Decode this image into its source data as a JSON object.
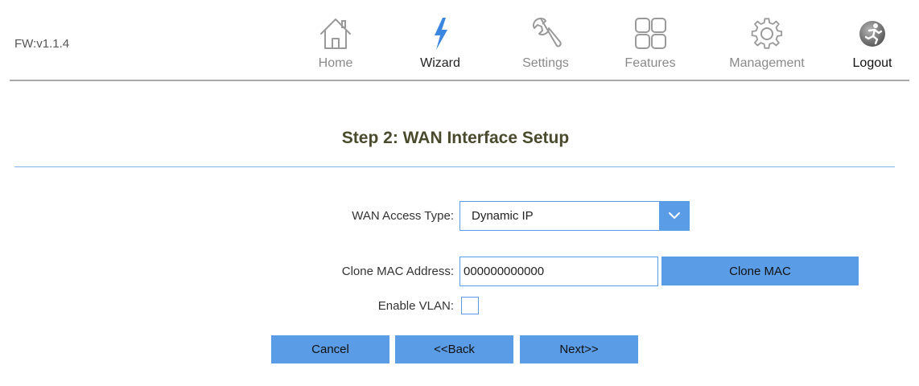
{
  "header": {
    "firmware_version": "FW:v1.1.4",
    "nav": [
      {
        "label": "Home",
        "icon": "home-icon",
        "active": false
      },
      {
        "label": "Wizard",
        "icon": "lightning-icon",
        "active": true
      },
      {
        "label": "Settings",
        "icon": "wrench-icon",
        "active": false
      },
      {
        "label": "Features",
        "icon": "grid-icon",
        "active": false
      },
      {
        "label": "Management",
        "icon": "gear-icon",
        "active": false
      },
      {
        "label": "Logout",
        "icon": "logout-runner-icon",
        "active": false
      }
    ]
  },
  "page": {
    "title": "Step 2: WAN Interface Setup"
  },
  "form": {
    "wan_access_type": {
      "label": "WAN Access Type:",
      "selected": "Dynamic IP"
    },
    "clone_mac": {
      "label": "Clone MAC Address:",
      "value": "000000000000",
      "button_label": "Clone MAC"
    },
    "enable_vlan": {
      "label": "Enable VLAN:",
      "checked": false
    }
  },
  "actions": {
    "cancel_label": "Cancel",
    "back_label": "<<Back",
    "next_label": "Next>>"
  },
  "colors": {
    "accent": "#5b9ce6",
    "wizard_icon": "#3a86e0",
    "nav_icon": "#9a9a9a",
    "title": "#4a4a2e"
  }
}
